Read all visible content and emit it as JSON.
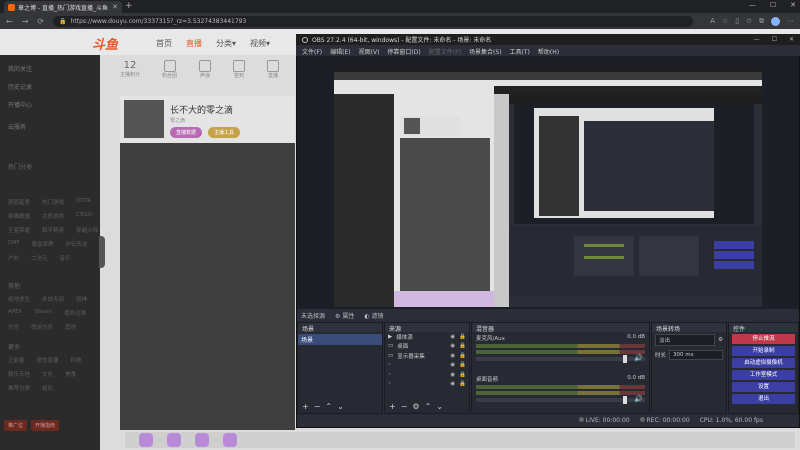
{
  "browser": {
    "tab_title": "章之博 - 直播_热门游戏直播_斗鱼",
    "tab_close": "✕",
    "new_tab": "+",
    "url": "https://www.douyu.com/3337315?_rz=3.53274383441793",
    "window_controls": [
      "—",
      "☐",
      "✕"
    ],
    "nav": [
      "←",
      "→",
      "⟳"
    ]
  },
  "douyu": {
    "logo": "斗鱼",
    "nav": [
      {
        "label": "首页",
        "active": false
      },
      {
        "label": "直播",
        "active": true
      },
      {
        "label": "分类▾",
        "active": false
      },
      {
        "label": "视频▾",
        "active": false
      }
    ],
    "stats": [
      {
        "value": "12",
        "label": "主播积分"
      },
      {
        "value": "",
        "label": "粉丝团"
      },
      {
        "value": "",
        "label": "声浪"
      },
      {
        "value": "",
        "label": "签到"
      },
      {
        "value": "",
        "label": "直播"
      }
    ],
    "profile": {
      "name": "长不大的零之滴",
      "sub": "零之滴",
      "btn1": "直播数据",
      "btn2": "主播工具"
    },
    "left_nav": {
      "items": [
        "我的关注",
        "历史记录",
        "开播中心",
        "云服务"
      ],
      "section_hot": "热门分类",
      "hot_rows": [
        [
          "颜值星秀",
          "热门游戏",
          "DOTA"
        ],
        [
          "英雄联盟",
          "主机游戏",
          "CSGO"
        ],
        [
          "王者荣耀",
          "和平精英",
          "穿越火线"
        ],
        [
          "DNF",
          "魔兽世界",
          "炉石传说"
        ],
        [
          "户外",
          "二次元",
          "音乐"
        ]
      ],
      "section_others": "其他",
      "other_rows": [
        [
          "绝地求生",
          "永劫无间",
          "原神"
        ],
        [
          "APEX",
          "Steam",
          "使命召唤"
        ],
        [
          "方舟",
          "命运方舟",
          "其他"
        ]
      ],
      "section_more": "更多",
      "more_rows": [
        [
          "正能量",
          "语言直播",
          "科技"
        ],
        [
          "娱乐天地",
          "文化",
          "美食"
        ],
        [
          "推荐分类",
          "组队"
        ]
      ],
      "foot_btns": [
        "推广位",
        "开播指南"
      ]
    }
  },
  "obs": {
    "title": "OBS 27.2.4 (64-bit, windows) - 配置文件: 未命名 - 场景: 未命名",
    "window_controls": [
      "—",
      "☐",
      "✕"
    ],
    "menu": [
      "文件(F)",
      "编辑(E)",
      "视图(V)",
      "停靠窗口(D)",
      "配置文件(P)",
      "场景集合(S)",
      "工具(T)",
      "帮助(H)"
    ],
    "menu_disabled": [
      false,
      false,
      false,
      false,
      true,
      false,
      false,
      false
    ],
    "status_row": {
      "source_label": "未选择源",
      "props": "属性",
      "filters": "滤镜"
    },
    "scenes": {
      "header": "场景",
      "items": [
        "场景"
      ]
    },
    "sources": {
      "header": "来源",
      "items": [
        "媒体源",
        "桌面",
        "显示器采集",
        "",
        "",
        "",
        ""
      ]
    },
    "mixer": {
      "header": "混音器",
      "channels": [
        {
          "name": "麦克风/Aux",
          "db": "0.0 dB"
        },
        {
          "name": "桌面音频",
          "db": "0.0 dB"
        }
      ]
    },
    "transitions": {
      "header": "场景转场",
      "type": "淡出",
      "duration_label": "时长",
      "duration": "300 ms"
    },
    "controls": {
      "header": "控件",
      "buttons": [
        "停止推流",
        "开始录制",
        "启动虚拟摄像机",
        "工作室模式",
        "设置",
        "退出"
      ]
    },
    "status": {
      "live": "LIVE: 00:00:00",
      "rec": "REC: 00:00:00",
      "cpu": "CPU: 1.0%, 60.00 fps"
    },
    "tools": {
      "add": "+",
      "remove": "−",
      "up": "⌃",
      "down": "⌄",
      "gear": "⚙"
    }
  }
}
